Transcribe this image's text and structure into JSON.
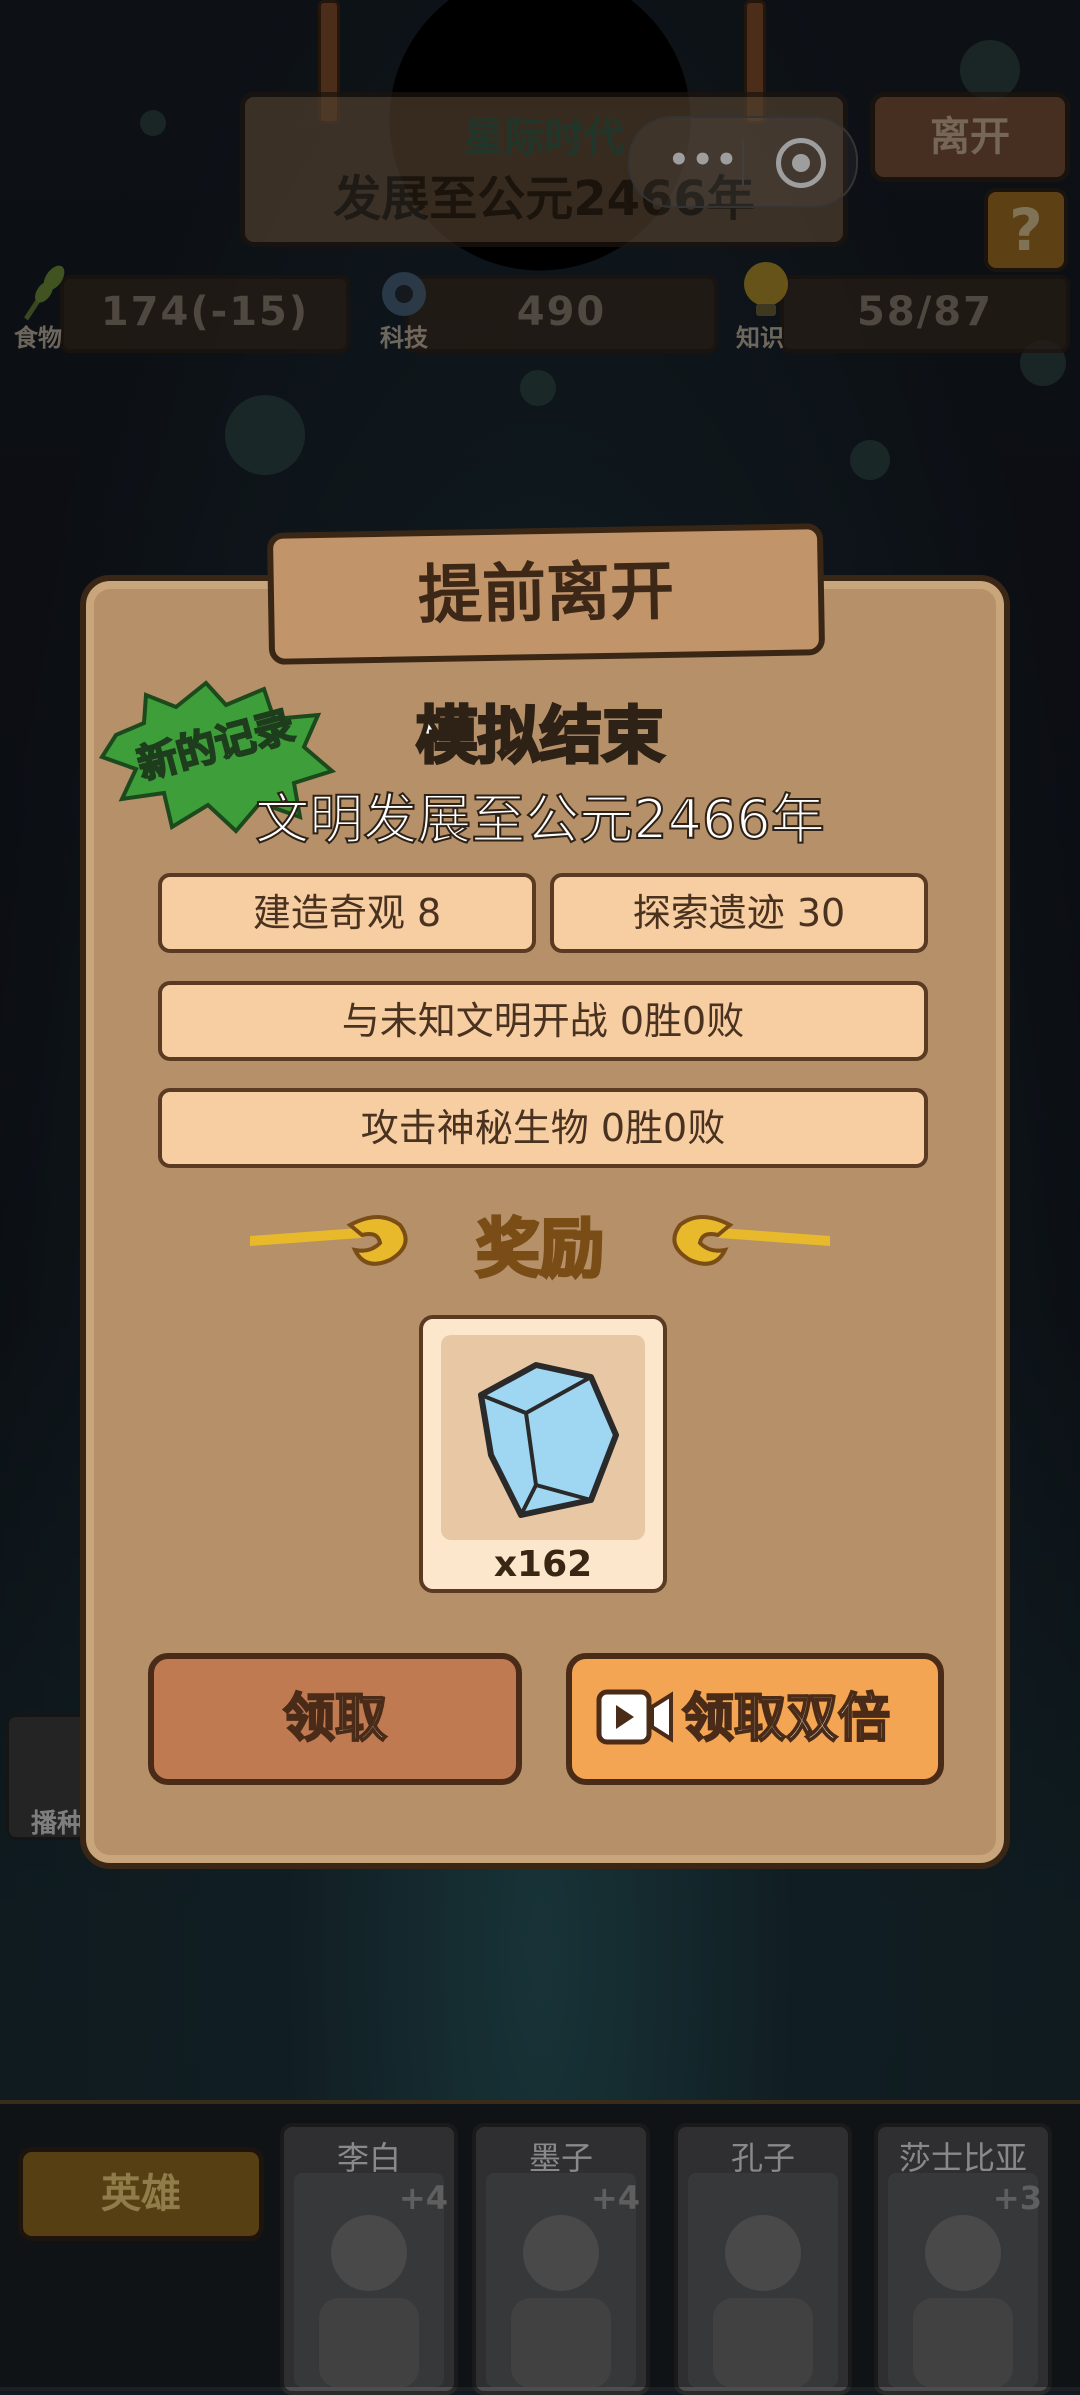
{
  "top": {
    "era": "星际时代",
    "year_text": "发展至公元2466年",
    "leave_label": "离开",
    "help_label": "?"
  },
  "resources": {
    "food": {
      "label": "食物",
      "value": "174(-15)"
    },
    "tech": {
      "label": "科技",
      "value": "490"
    },
    "knowledge": {
      "label": "知识",
      "value": "58/87"
    }
  },
  "side_tab": {
    "label": "播种"
  },
  "dialog": {
    "title": "提前离开",
    "badge": "新的记录",
    "result_title": "模拟结束",
    "result_subtitle": "文明发展至公元2466年",
    "stats": {
      "wonders": "建造奇观 8",
      "ruins": "探索遗迹 30",
      "war": "与未知文明开战  0胜0败",
      "creatures": "攻击神秘生物  0胜0败"
    },
    "reward_title": "奖励",
    "reward": {
      "item_icon": "blue-crystal-icon",
      "count": "x162"
    },
    "claim_label": "领取",
    "claim_double_label": "领取双倍"
  },
  "heroes": {
    "button_label": "英雄",
    "list": [
      {
        "name": "李白",
        "plus": "+4"
      },
      {
        "name": "墨子",
        "plus": "+4"
      },
      {
        "name": "孔子",
        "plus": ""
      },
      {
        "name": "莎士比亚",
        "plus": "+3"
      }
    ]
  },
  "colors": {
    "panel": "#b59068",
    "stat_box": "#f7cea2",
    "reward_gold": "#e7b92b",
    "claim_button": "#c07a52",
    "double_button": "#f4a553",
    "badge_green": "#3e9e3a"
  }
}
